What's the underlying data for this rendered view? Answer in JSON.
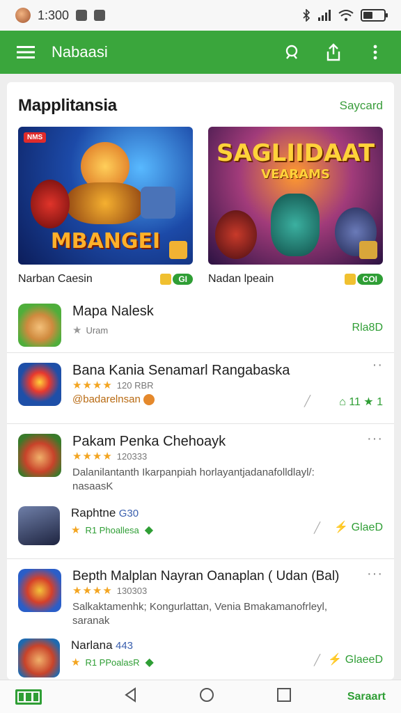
{
  "status": {
    "time": "1:300"
  },
  "app_bar": {
    "title": "Nabaasi",
    "icons": [
      "menu-icon",
      "search-icon",
      "share-icon",
      "more-vert-icon"
    ]
  },
  "section": {
    "title": "Mapplitansia",
    "see_all": "Saycard"
  },
  "banners": [
    {
      "name": "Narban Caesin",
      "badge": "NMS",
      "art_text": "MBANGEI",
      "tag": "GI",
      "image": "hero-fighter-art"
    },
    {
      "name": "Nadan lpeain",
      "art_text": "SAGLIIDAAT",
      "art_subtext": "VEARAMS",
      "tag": "COI",
      "image": "battle-crowd-art"
    }
  ],
  "apps": [
    {
      "title": "Mapa Nalesk",
      "meta": "Uram",
      "action": "Rla8D",
      "icon": "cartoon-face-icon"
    },
    {
      "title": "Bana Kania Senamarl Rangabaska",
      "stars": "★★★★",
      "meta": "120 RBR",
      "developer": "@badarelnsan",
      "rating": "11",
      "icon": "blue-shield-icon"
    },
    {
      "title": "Pakam Penka Chehoayk",
      "stars": "★★★★",
      "meta": "120333",
      "description": "Dalanilantanth Ikarpanpiah horlayantjadanafolldlayl/: nasaasK",
      "icon": "red-hero-icon"
    },
    {
      "title": "Raphtne",
      "subtitle": "G30",
      "stars": "★",
      "meta": "R1 Phoallesa",
      "action": "GlaeD",
      "icon": "jet-icon"
    },
    {
      "title": "Bepth Malplan Nayran Oanaplan ( Udan (Bal)",
      "stars": "★★★★",
      "meta": "130303",
      "description": "Salkaktamenhk; Kongurlattan, Venia Bmakamanofrleyl, saranak",
      "icon": "mask-icon"
    },
    {
      "title": "Narlana",
      "subtitle": "443",
      "stars": "★",
      "meta": "R1 PPoalasR",
      "action": "GlaeeD",
      "icon": "warrior-icon"
    }
  ],
  "nav": {
    "label": "Saraart",
    "icons": [
      "store-logo-icon",
      "back-icon",
      "home-icon",
      "recents-icon"
    ]
  },
  "colors": {
    "primary": "#3aa63c",
    "accent": "#2f9e35",
    "star": "#f3a521"
  }
}
